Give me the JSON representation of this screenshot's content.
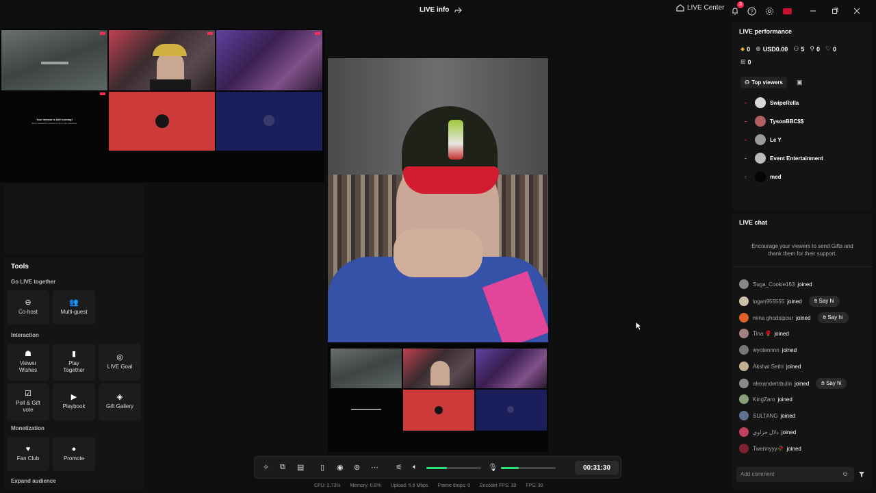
{
  "titlebar": {
    "live_info": "LIVE info",
    "live_center": "LIVE Center",
    "notification_count": "3"
  },
  "mosaic": {
    "msg_line1": "Your stream is still running!",
    "msg_line2": "We've paused the preview to save your resources."
  },
  "tools": {
    "title": "Tools",
    "sections": {
      "go_live_together": "Go LIVE together",
      "interaction": "Interaction",
      "monetization": "Monetization",
      "expand_audience": "Expand audience"
    },
    "items": {
      "cohost": "Co-host",
      "multiguest": "Multi-guest",
      "viewer_wishes": "Viewer Wishes",
      "play_together": "Play Together",
      "live_goal": "LIVE Goal",
      "poll_gift_vote": "Poll & Gift vote",
      "playbook": "Playbook",
      "gift_gallery": "Gift Gallery",
      "fan_club": "Fan Club",
      "promote": "Promote"
    }
  },
  "controls": {
    "timer": "00:31:30",
    "volume_level": 0.38,
    "mic_level": 0.33
  },
  "stats": {
    "cpu": "CPU: 2.73%",
    "memory": "Memory: 0.8%",
    "upload": "Upload: 5.6 Mbps",
    "frame_drops": "Frame drops: 0",
    "encoder_fps": "Encoder FPS: 30",
    "fps": "FPS: 30"
  },
  "performance": {
    "title": "LIVE performance",
    "diamonds": "0",
    "usd": "USD0.00",
    "viewers": "5",
    "followers": "0",
    "likes": "0",
    "gifts": "0",
    "top_viewers_tab": "Top viewers",
    "top_viewers": [
      {
        "name": "SwipeRella",
        "color": "#d8d8d8"
      },
      {
        "name": "TysonBBC$$",
        "color": "#b06060"
      },
      {
        "name": "Le Y",
        "color": "#9a9a9a"
      },
      {
        "name": "Event Entertainment",
        "color": "#bbbbbb"
      },
      {
        "name": "med",
        "color": "#050505"
      }
    ]
  },
  "chat": {
    "title": "LIVE chat",
    "encourage_line1": "Encourage your viewers to send Gifts and",
    "encourage_line2": "thank them for their support.",
    "joined_label": "joined",
    "say_hi_label": "Say hi",
    "messages": [
      {
        "name": "Suga_Cookie163",
        "say_hi": false,
        "color": "#888888"
      },
      {
        "name": "logan955555",
        "say_hi": true,
        "color": "#c8c0a8"
      },
      {
        "name": "mina ghodsipour",
        "say_hi": true,
        "color": "#e0602a"
      },
      {
        "name": "Tina 🌹",
        "say_hi": false,
        "color": "#a08080"
      },
      {
        "name": "wyotennnn",
        "say_hi": false,
        "color": "#777777"
      },
      {
        "name": "Akshat Sethi",
        "say_hi": false,
        "color": "#c0b090"
      },
      {
        "name": "alexandertrbulin",
        "say_hi": true,
        "color": "#8a8a8a"
      },
      {
        "name": "KingZaro",
        "say_hi": false,
        "color": "#8aa07a"
      },
      {
        "name": "SULTANG",
        "say_hi": false,
        "color": "#607090"
      },
      {
        "name": "دلال حزاوي",
        "say_hi": false,
        "color": "#c04060"
      },
      {
        "name": "Twennyyy🥀",
        "say_hi": false,
        "color": "#802030"
      }
    ],
    "comment_placeholder": "Add comment"
  },
  "colors": {
    "accent": "#fe2c55",
    "level_green": "#2de07a"
  }
}
